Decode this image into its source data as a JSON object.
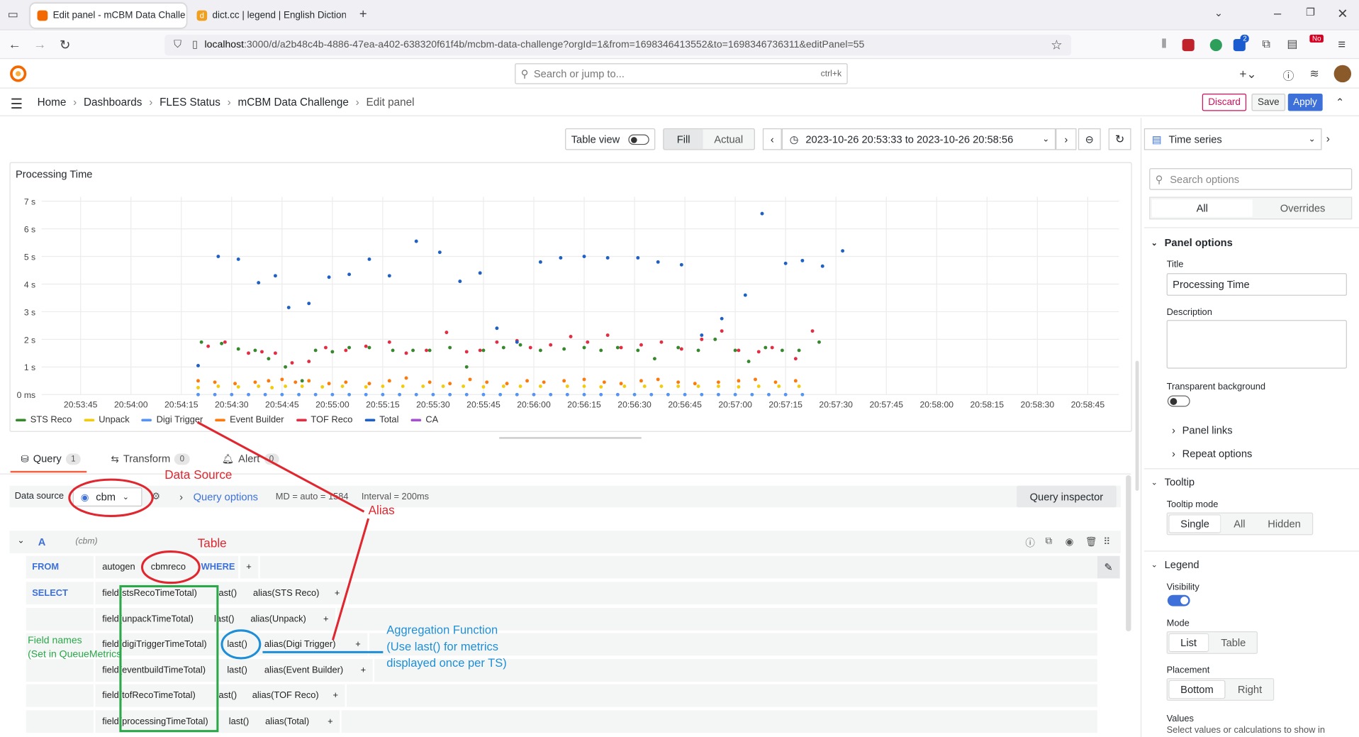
{
  "browser": {
    "tabs": [
      {
        "title": "Edit panel - mCBM Data Challe",
        "active": true
      },
      {
        "title": "dict.cc | legend | English Diction",
        "active": false
      }
    ],
    "url_host": "localhost",
    "url_rest": ":3000/d/a2b48c4b-4886-47ea-a402-638320f61f4b/mcbm-data-challenge?orgId=1&from=1698346413552&to=1698346736311&editPanel=55",
    "ext_badge_count": "2",
    "ext_badge_no": "No"
  },
  "grafana": {
    "search_placeholder": "Search or jump to...",
    "search_shortcut": "ctrl+k",
    "breadcrumbs": [
      "Home",
      "Dashboards",
      "FLES Status",
      "mCBM Data Challenge",
      "Edit panel"
    ],
    "actions": {
      "discard": "Discard",
      "save": "Save",
      "apply": "Apply"
    },
    "toolbar": {
      "table_view": "Table view",
      "fill": "Fill",
      "actual": "Actual",
      "time_range": "2023-10-26 20:53:33 to 2023-10-26 20:58:56",
      "viz": "Time series"
    }
  },
  "panel": {
    "title": "Processing Time"
  },
  "chart_data": {
    "type": "scatter",
    "title": "Processing Time",
    "y_ticks": [
      "0 ms",
      "1 s",
      "2 s",
      "3 s",
      "4 s",
      "5 s",
      "6 s",
      "7 s"
    ],
    "ylim": [
      0,
      7
    ],
    "x_ticks": [
      "20:53:45",
      "20:54:00",
      "20:54:15",
      "20:54:30",
      "20:54:45",
      "20:55:00",
      "20:55:15",
      "20:55:30",
      "20:55:45",
      "20:56:00",
      "20:56:15",
      "20:56:30",
      "20:56:45",
      "20:57:00",
      "20:57:15",
      "20:57:30",
      "20:57:45",
      "20:58:00",
      "20:58:15",
      "20:58:30",
      "20:58:45"
    ],
    "x_unit": "seconds since 20:53:45",
    "grid": true,
    "legend_placement": "bottom",
    "series": [
      {
        "name": "STS Reco",
        "color": "#37872d",
        "points": [
          [
            36,
            1.9
          ],
          [
            42,
            1.85
          ],
          [
            47,
            1.65
          ],
          [
            52,
            1.6
          ],
          [
            56,
            1.3
          ],
          [
            61,
            1.0
          ],
          [
            66,
            0.5
          ],
          [
            70,
            1.6
          ],
          [
            75,
            1.55
          ],
          [
            80,
            1.7
          ],
          [
            86,
            1.7
          ],
          [
            93,
            1.6
          ],
          [
            99,
            1.6
          ],
          [
            104,
            1.6
          ],
          [
            110,
            1.7
          ],
          [
            115,
            1.0
          ],
          [
            120,
            1.6
          ],
          [
            126,
            1.7
          ],
          [
            131,
            1.8
          ],
          [
            137,
            1.6
          ],
          [
            144,
            1.65
          ],
          [
            150,
            1.7
          ],
          [
            155,
            1.6
          ],
          [
            160,
            1.7
          ],
          [
            166,
            1.6
          ],
          [
            171,
            1.3
          ],
          [
            178,
            1.7
          ],
          [
            184,
            1.6
          ],
          [
            189,
            2.0
          ],
          [
            195,
            1.6
          ],
          [
            199,
            1.2
          ],
          [
            204,
            1.7
          ],
          [
            209,
            1.6
          ],
          [
            214,
            1.6
          ],
          [
            220,
            1.9
          ]
        ]
      },
      {
        "name": "Unpack",
        "color": "#f2cc0c",
        "points": [
          [
            35,
            0.25
          ],
          [
            41,
            0.3
          ],
          [
            47,
            0.28
          ],
          [
            53,
            0.3
          ],
          [
            57,
            0.25
          ],
          [
            61,
            0.3
          ],
          [
            66,
            0.3
          ],
          [
            72,
            0.28
          ],
          [
            78,
            0.3
          ],
          [
            85,
            0.28
          ],
          [
            90,
            0.3
          ],
          [
            96,
            0.3
          ],
          [
            102,
            0.3
          ],
          [
            108,
            0.3
          ],
          [
            114,
            0.3
          ],
          [
            120,
            0.28
          ],
          [
            126,
            0.3
          ],
          [
            131,
            0.3
          ],
          [
            137,
            0.3
          ],
          [
            145,
            0.3
          ],
          [
            150,
            0.3
          ],
          [
            155,
            0.28
          ],
          [
            162,
            0.3
          ],
          [
            168,
            0.3
          ],
          [
            173,
            0.3
          ],
          [
            178,
            0.3
          ],
          [
            184,
            0.3
          ],
          [
            190,
            0.3
          ],
          [
            196,
            0.28
          ],
          [
            202,
            0.3
          ],
          [
            208,
            0.3
          ],
          [
            214,
            0.3
          ]
        ]
      },
      {
        "name": "Digi Trigger",
        "color": "#5794f2",
        "points": [
          [
            35,
            0.0
          ],
          [
            40,
            0.0
          ],
          [
            45,
            0.0
          ],
          [
            50,
            0.0
          ],
          [
            55,
            0.0
          ],
          [
            60,
            0.0
          ],
          [
            65,
            0.0
          ],
          [
            70,
            0.0
          ],
          [
            75,
            0.0
          ],
          [
            80,
            0.0
          ],
          [
            85,
            0.0
          ],
          [
            90,
            0.0
          ],
          [
            95,
            0.0
          ],
          [
            100,
            0.0
          ],
          [
            105,
            0.0
          ],
          [
            110,
            0.0
          ],
          [
            115,
            0.0
          ],
          [
            120,
            0.0
          ],
          [
            125,
            0.0
          ],
          [
            130,
            0.0
          ],
          [
            135,
            0.0
          ],
          [
            140,
            0.0
          ],
          [
            145,
            0.0
          ],
          [
            150,
            0.0
          ],
          [
            155,
            0.0
          ],
          [
            160,
            0.0
          ],
          [
            165,
            0.0
          ],
          [
            170,
            0.0
          ],
          [
            175,
            0.0
          ],
          [
            180,
            0.0
          ],
          [
            185,
            0.0
          ],
          [
            190,
            0.0
          ],
          [
            195,
            0.0
          ],
          [
            200,
            0.0
          ],
          [
            205,
            0.0
          ],
          [
            210,
            0.0
          ],
          [
            215,
            0.0
          ]
        ]
      },
      {
        "name": "Event Builder",
        "color": "#ff780a",
        "points": [
          [
            35,
            0.5
          ],
          [
            40,
            0.45
          ],
          [
            46,
            0.4
          ],
          [
            52,
            0.45
          ],
          [
            56,
            0.5
          ],
          [
            60,
            0.55
          ],
          [
            64,
            0.45
          ],
          [
            68,
            0.5
          ],
          [
            74,
            0.4
          ],
          [
            79,
            0.45
          ],
          [
            86,
            0.4
          ],
          [
            92,
            0.5
          ],
          [
            97,
            0.6
          ],
          [
            104,
            0.45
          ],
          [
            110,
            0.4
          ],
          [
            116,
            0.55
          ],
          [
            121,
            0.45
          ],
          [
            127,
            0.4
          ],
          [
            133,
            0.5
          ],
          [
            138,
            0.45
          ],
          [
            144,
            0.5
          ],
          [
            150,
            0.55
          ],
          [
            156,
            0.45
          ],
          [
            161,
            0.4
          ],
          [
            167,
            0.5
          ],
          [
            172,
            0.55
          ],
          [
            178,
            0.45
          ],
          [
            183,
            0.4
          ],
          [
            190,
            0.45
          ],
          [
            196,
            0.5
          ],
          [
            201,
            0.55
          ],
          [
            207,
            0.45
          ],
          [
            213,
            0.5
          ]
        ]
      },
      {
        "name": "TOF Reco",
        "color": "#e02f44",
        "points": [
          [
            38,
            1.75
          ],
          [
            43,
            1.9
          ],
          [
            50,
            1.5
          ],
          [
            54,
            1.55
          ],
          [
            58,
            1.5
          ],
          [
            63,
            1.15
          ],
          [
            68,
            1.2
          ],
          [
            73,
            1.7
          ],
          [
            79,
            1.6
          ],
          [
            85,
            1.75
          ],
          [
            92,
            1.9
          ],
          [
            97,
            1.5
          ],
          [
            103,
            1.6
          ],
          [
            109,
            2.25
          ],
          [
            115,
            1.55
          ],
          [
            119,
            1.6
          ],
          [
            124,
            1.9
          ],
          [
            130,
            1.95
          ],
          [
            134,
            1.7
          ],
          [
            140,
            1.8
          ],
          [
            146,
            2.1
          ],
          [
            151,
            1.9
          ],
          [
            157,
            2.15
          ],
          [
            161,
            1.7
          ],
          [
            167,
            1.8
          ],
          [
            173,
            1.9
          ],
          [
            179,
            1.65
          ],
          [
            185,
            2.0
          ],
          [
            191,
            2.3
          ],
          [
            196,
            1.6
          ],
          [
            202,
            1.55
          ],
          [
            206,
            1.7
          ],
          [
            213,
            1.3
          ],
          [
            218,
            2.3
          ]
        ]
      },
      {
        "name": "Total",
        "color": "#1f60c4",
        "points": [
          [
            35,
            1.05
          ],
          [
            41,
            5.0
          ],
          [
            47,
            4.9
          ],
          [
            53,
            4.05
          ],
          [
            58,
            4.3
          ],
          [
            62,
            3.15
          ],
          [
            68,
            3.3
          ],
          [
            74,
            4.25
          ],
          [
            80,
            4.35
          ],
          [
            86,
            4.9
          ],
          [
            92,
            4.3
          ],
          [
            100,
            5.55
          ],
          [
            107,
            5.15
          ],
          [
            113,
            4.1
          ],
          [
            119,
            4.4
          ],
          [
            124,
            2.4
          ],
          [
            130,
            1.9
          ],
          [
            137,
            4.8
          ],
          [
            143,
            4.95
          ],
          [
            150,
            5.0
          ],
          [
            157,
            4.95
          ],
          [
            166,
            4.95
          ],
          [
            172,
            4.8
          ],
          [
            179,
            4.7
          ],
          [
            185,
            2.15
          ],
          [
            191,
            2.75
          ],
          [
            198,
            3.6
          ],
          [
            203,
            6.55
          ],
          [
            210,
            4.75
          ],
          [
            215,
            4.85
          ],
          [
            221,
            4.65
          ],
          [
            227,
            5.2
          ]
        ]
      },
      {
        "name": "CA",
        "color": "#a352cc",
        "points": []
      }
    ]
  },
  "query": {
    "tabs": [
      {
        "label": "Query",
        "count": "1"
      },
      {
        "label": "Transform",
        "count": "0"
      },
      {
        "label": "Alert",
        "count": "0"
      }
    ],
    "data_source_label": "Data source",
    "data_source": "cbm",
    "query_options": "Query options",
    "md": "MD = auto = 1584",
    "interval": "Interval = 200ms",
    "inspector": "Query inspector",
    "ref_id": "A",
    "ref_ds": "(cbm)",
    "from_kw": "FROM",
    "policy": "autogen",
    "measurement": "cbmreco",
    "where_kw": "WHERE",
    "select_kw": "SELECT",
    "plus": "+",
    "selects": [
      {
        "field": "field(stsRecoTimeTotal)",
        "fn": "last()",
        "alias": "alias(STS Reco)"
      },
      {
        "field": "field(unpackTimeTotal)",
        "fn": "last()",
        "alias": "alias(Unpack)"
      },
      {
        "field": "field(digiTriggerTimeTotal)",
        "fn": "last()",
        "alias": "alias(Digi Trigger)"
      },
      {
        "field": "field(eventbuildTimeTotal)",
        "fn": "last()",
        "alias": "alias(Event Builder)"
      },
      {
        "field": "field(tofRecoTimeTotal)",
        "fn": "last()",
        "alias": "alias(TOF Reco)"
      },
      {
        "field": "field(processingTimeTotal)",
        "fn": "last()",
        "alias": "alias(Total)"
      }
    ]
  },
  "options": {
    "search_placeholder": "Search options",
    "all": "All",
    "overrides": "Overrides",
    "panel_options": "Panel options",
    "title_label": "Title",
    "title_value": "Processing Time",
    "description_label": "Description",
    "transparent_label": "Transparent background",
    "panel_links": "Panel links",
    "repeat_options": "Repeat options",
    "tooltip": "Tooltip",
    "tooltip_mode": "Tooltip mode",
    "tooltip_opts": [
      "Single",
      "All",
      "Hidden"
    ],
    "legend": "Legend",
    "visibility": "Visibility",
    "mode": "Mode",
    "mode_opts": [
      "List",
      "Table"
    ],
    "placement": "Placement",
    "placement_opts": [
      "Bottom",
      "Right"
    ],
    "values": "Values",
    "values_desc": "Select values or calculations to show in"
  },
  "annotations": {
    "data_source": "Data Source",
    "table": "Table",
    "alias": "Alias",
    "field_names_1": "Field names",
    "field_names_2": "(Set in QueueMetrics",
    "agg_1": "Aggregation Function",
    "agg_2": "(Use last() for metrics",
    "agg_3": "displayed once per TS)",
    "red": "#e0262e",
    "blue": "#1e8fd6",
    "green": "#2aa84a"
  }
}
